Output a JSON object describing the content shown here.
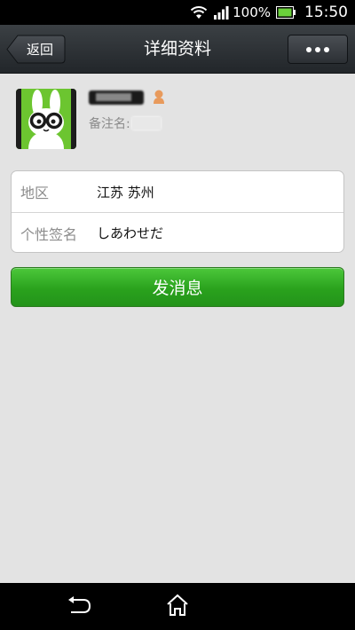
{
  "status_bar": {
    "battery_percent": "100%",
    "time": "15:50",
    "icons": [
      "wifi-icon",
      "signal-icon",
      "battery-icon"
    ]
  },
  "header": {
    "back_label": "返回",
    "title": "详细资料",
    "more_icon": "more-icon"
  },
  "profile": {
    "avatar_icon": "rabbit-avatar",
    "gender_icon": "gender-icon",
    "remark_label": "备注名:"
  },
  "details": [
    {
      "label": "地区",
      "value": "江苏  苏州"
    },
    {
      "label": "个性签名",
      "value": "しあわせだ"
    }
  ],
  "actions": {
    "send_message_label": "发消息"
  },
  "nav_bar": {
    "icons": [
      "back-icon",
      "home-icon"
    ]
  },
  "colors": {
    "accent_green": "#2aa21d",
    "content_bg": "#e3e3e3",
    "header_bg": "#2c3034"
  }
}
